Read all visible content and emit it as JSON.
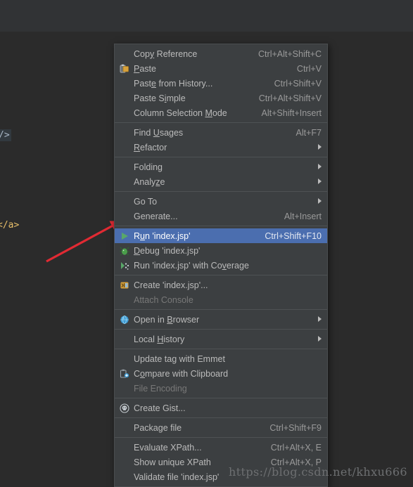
{
  "editor": {
    "background_color": "#2b2b2b",
    "toolbar_band_color": "#313335",
    "code_fragments": [
      {
        "text": "/>",
        "color": "#a9b7c6"
      },
      {
        "text": "</a>",
        "color": "#e8bf6a"
      }
    ]
  },
  "annotation": {
    "type": "arrow",
    "color": "#e12a33",
    "points_to": "Run 'index.jsp'"
  },
  "menu": {
    "name": "editor-context-menu",
    "background_color": "#3c3f41",
    "selected_color": "#4b6eaf",
    "groups": [
      {
        "items": [
          {
            "label": "Copy Reference",
            "shortcut": "Ctrl+Alt+Shift+C",
            "icon": "",
            "mnemonic": "y",
            "submenu": false,
            "disabled": false,
            "selected": false
          },
          {
            "label": "Paste",
            "shortcut": "Ctrl+V",
            "icon": "paste-icon",
            "mnemonic": "P",
            "submenu": false,
            "disabled": false,
            "selected": false
          },
          {
            "label": "Paste from History...",
            "shortcut": "Ctrl+Shift+V",
            "icon": "",
            "mnemonic": "e",
            "submenu": false,
            "disabled": false,
            "selected": false
          },
          {
            "label": "Paste Simple",
            "shortcut": "Ctrl+Alt+Shift+V",
            "icon": "",
            "mnemonic": "i",
            "submenu": false,
            "disabled": false,
            "selected": false
          },
          {
            "label": "Column Selection Mode",
            "shortcut": "Alt+Shift+Insert",
            "icon": "",
            "mnemonic": "M",
            "submenu": false,
            "disabled": false,
            "selected": false
          }
        ]
      },
      {
        "items": [
          {
            "label": "Find Usages",
            "shortcut": "Alt+F7",
            "icon": "",
            "mnemonic": "U",
            "submenu": false,
            "disabled": false,
            "selected": false
          },
          {
            "label": "Refactor",
            "shortcut": "",
            "icon": "",
            "mnemonic": "R",
            "submenu": true,
            "disabled": false,
            "selected": false
          }
        ]
      },
      {
        "items": [
          {
            "label": "Folding",
            "shortcut": "",
            "icon": "",
            "mnemonic": "",
            "submenu": true,
            "disabled": false,
            "selected": false
          },
          {
            "label": "Analyze",
            "shortcut": "",
            "icon": "",
            "mnemonic": "z",
            "submenu": true,
            "disabled": false,
            "selected": false
          }
        ]
      },
      {
        "items": [
          {
            "label": "Go To",
            "shortcut": "",
            "icon": "",
            "mnemonic": "",
            "submenu": true,
            "disabled": false,
            "selected": false
          },
          {
            "label": "Generate...",
            "shortcut": "Alt+Insert",
            "icon": "",
            "mnemonic": "",
            "submenu": false,
            "disabled": false,
            "selected": false
          }
        ]
      },
      {
        "items": [
          {
            "label": "Run 'index.jsp'",
            "shortcut": "Ctrl+Shift+F10",
            "icon": "run-icon",
            "mnemonic": "u",
            "submenu": false,
            "disabled": false,
            "selected": true
          },
          {
            "label": "Debug 'index.jsp'",
            "shortcut": "",
            "icon": "debug-icon",
            "mnemonic": "D",
            "submenu": false,
            "disabled": false,
            "selected": false
          },
          {
            "label": "Run 'index.jsp' with Coverage",
            "shortcut": "",
            "icon": "coverage-icon",
            "mnemonic": "v",
            "submenu": false,
            "disabled": false,
            "selected": false
          }
        ]
      },
      {
        "items": [
          {
            "label": "Create 'index.jsp'...",
            "shortcut": "",
            "icon": "create-config-icon",
            "mnemonic": "",
            "submenu": false,
            "disabled": false,
            "selected": false
          },
          {
            "label": "Attach Console",
            "shortcut": "",
            "icon": "",
            "mnemonic": "",
            "submenu": false,
            "disabled": true,
            "selected": false
          }
        ]
      },
      {
        "items": [
          {
            "label": "Open in Browser",
            "shortcut": "",
            "icon": "globe-icon",
            "mnemonic": "B",
            "submenu": true,
            "disabled": false,
            "selected": false
          }
        ]
      },
      {
        "items": [
          {
            "label": "Local History",
            "shortcut": "",
            "icon": "",
            "mnemonic": "H",
            "submenu": true,
            "disabled": false,
            "selected": false
          }
        ]
      },
      {
        "items": [
          {
            "label": "Update tag with Emmet",
            "shortcut": "",
            "icon": "",
            "mnemonic": "",
            "submenu": false,
            "disabled": false,
            "selected": false
          },
          {
            "label": "Compare with Clipboard",
            "shortcut": "",
            "icon": "compare-clipboard-icon",
            "mnemonic": "o",
            "submenu": false,
            "disabled": false,
            "selected": false
          },
          {
            "label": "File Encoding",
            "shortcut": "",
            "icon": "",
            "mnemonic": "",
            "submenu": false,
            "disabled": true,
            "selected": false
          }
        ]
      },
      {
        "items": [
          {
            "label": "Create Gist...",
            "shortcut": "",
            "icon": "gist-icon",
            "mnemonic": "",
            "submenu": false,
            "disabled": false,
            "selected": false
          }
        ]
      },
      {
        "items": [
          {
            "label": "Package file",
            "shortcut": "Ctrl+Shift+F9",
            "icon": "",
            "mnemonic": "",
            "submenu": false,
            "disabled": false,
            "selected": false
          }
        ]
      },
      {
        "items": [
          {
            "label": "Evaluate XPath...",
            "shortcut": "Ctrl+Alt+X, E",
            "icon": "",
            "mnemonic": "",
            "submenu": false,
            "disabled": false,
            "selected": false
          },
          {
            "label": "Show unique XPath",
            "shortcut": "Ctrl+Alt+X, P",
            "icon": "",
            "mnemonic": "",
            "submenu": false,
            "disabled": false,
            "selected": false
          },
          {
            "label": "Validate file 'index.jsp'",
            "shortcut": "",
            "icon": "",
            "mnemonic": "",
            "submenu": false,
            "disabled": false,
            "selected": false
          }
        ]
      }
    ]
  },
  "watermark": {
    "text": "https://blog.csdn.net/khxu666"
  }
}
